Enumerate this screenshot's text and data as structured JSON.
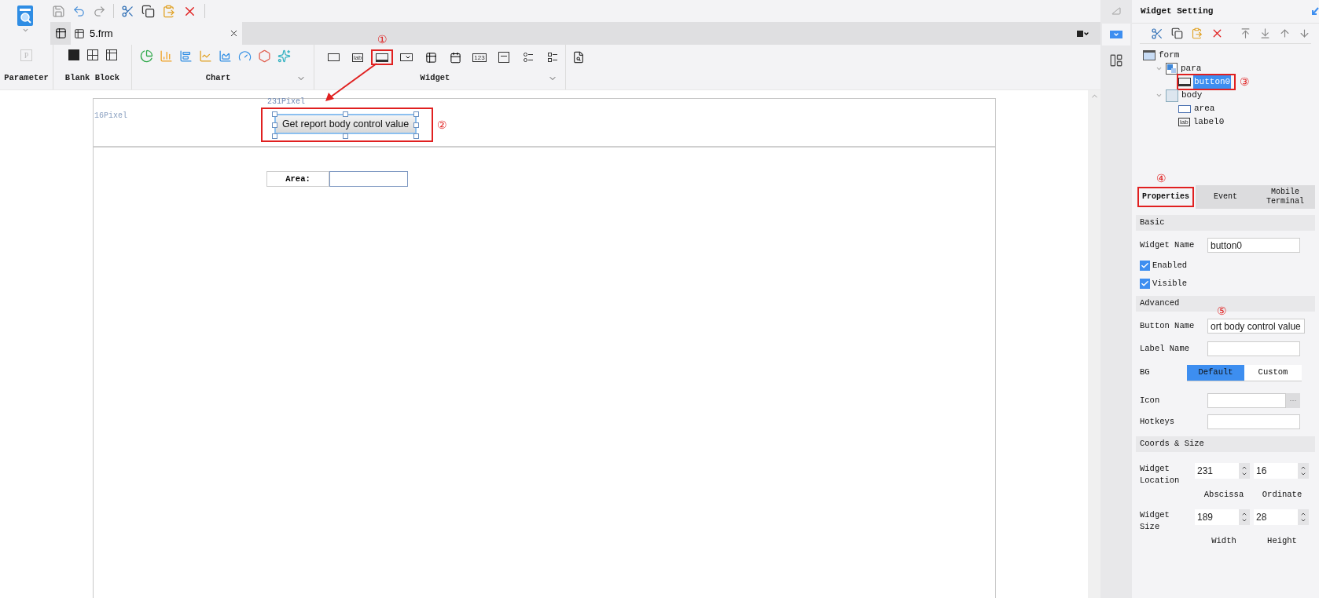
{
  "tabs": [
    {
      "label": "5.frm",
      "selected": true
    }
  ],
  "ribbon": {
    "parameter": {
      "label": "Parameter",
      "glyph": "P",
      "disabled": true
    },
    "blank_block": {
      "label": "Blank Block"
    },
    "chart": {
      "label": "Chart"
    },
    "widget": {
      "label": "Widget",
      "tools": [
        {
          "highlighted": false
        },
        {
          "highlighted": false,
          "glyph": "lab"
        },
        {
          "highlighted": true,
          "mark": "①"
        },
        {
          "highlighted": false
        },
        {
          "highlighted": false
        },
        {
          "highlighted": false
        },
        {
          "highlighted": false,
          "glyph": "123"
        },
        {
          "highlighted": false
        },
        {
          "highlighted": false
        },
        {
          "highlighted": false
        }
      ]
    }
  },
  "canvas": {
    "para": {
      "ruler_x": "231Pixel",
      "ruler_y": "16Pixel",
      "button": {
        "label": "Get report body control value",
        "selected": true,
        "mark": "②"
      }
    },
    "body": {
      "label": "Area:"
    }
  },
  "panel": {
    "title": "Widget Setting",
    "tree": [
      {
        "label": "form",
        "kind": "form",
        "selected": false,
        "children": [
          {
            "label": "para",
            "kind": "para",
            "selected": false,
            "expanded": true,
            "children": [
              {
                "label": "button0",
                "kind": "button",
                "selected": true,
                "mark": "③"
              }
            ]
          },
          {
            "label": "body",
            "kind": "body",
            "selected": false,
            "expanded": true,
            "children": [
              {
                "label": "area",
                "kind": "field",
                "selected": false
              },
              {
                "label": "label0",
                "kind": "label",
                "glyph": "lab",
                "selected": false
              }
            ]
          }
        ]
      }
    ],
    "tabs": [
      {
        "label": "Properties",
        "selected": true,
        "mark": "④"
      },
      {
        "label": "Event",
        "selected": false
      },
      {
        "label": "Mobile Terminal",
        "selected": false
      }
    ],
    "sections": [
      {
        "title": "Basic",
        "rows": [
          {
            "kind": "text",
            "label": "Widget Name",
            "value": "button0"
          },
          {
            "kind": "check",
            "label": "Enabled",
            "checked": true
          },
          {
            "kind": "check",
            "label": "Visible",
            "checked": true
          }
        ]
      },
      {
        "title": "Advanced",
        "rows": [
          {
            "kind": "text",
            "label": "Button Name",
            "value": "ort body control value",
            "mark": "⑤"
          },
          {
            "kind": "text",
            "label": "Label Name"
          },
          {
            "kind": "toggle",
            "label": "BG",
            "options": [
              {
                "label": "Default",
                "selected": true
              },
              {
                "label": "Custom",
                "selected": false
              }
            ]
          },
          {
            "kind": "picker",
            "label": "Icon",
            "button": "···"
          },
          {
            "kind": "text",
            "label": "Hotkeys"
          }
        ]
      },
      {
        "title": "Coords & Size",
        "rows": [
          {
            "kind": "spinners",
            "label": "Widget Location",
            "fields": [
              {
                "value": "231",
                "caption": "Abscissa"
              },
              {
                "value": "16",
                "caption": "Ordinate"
              }
            ]
          },
          {
            "kind": "spinners",
            "label": "Widget Size",
            "fields": [
              {
                "value": "189",
                "caption": "Width"
              },
              {
                "value": "28",
                "caption": "Height"
              }
            ]
          }
        ]
      }
    ]
  }
}
